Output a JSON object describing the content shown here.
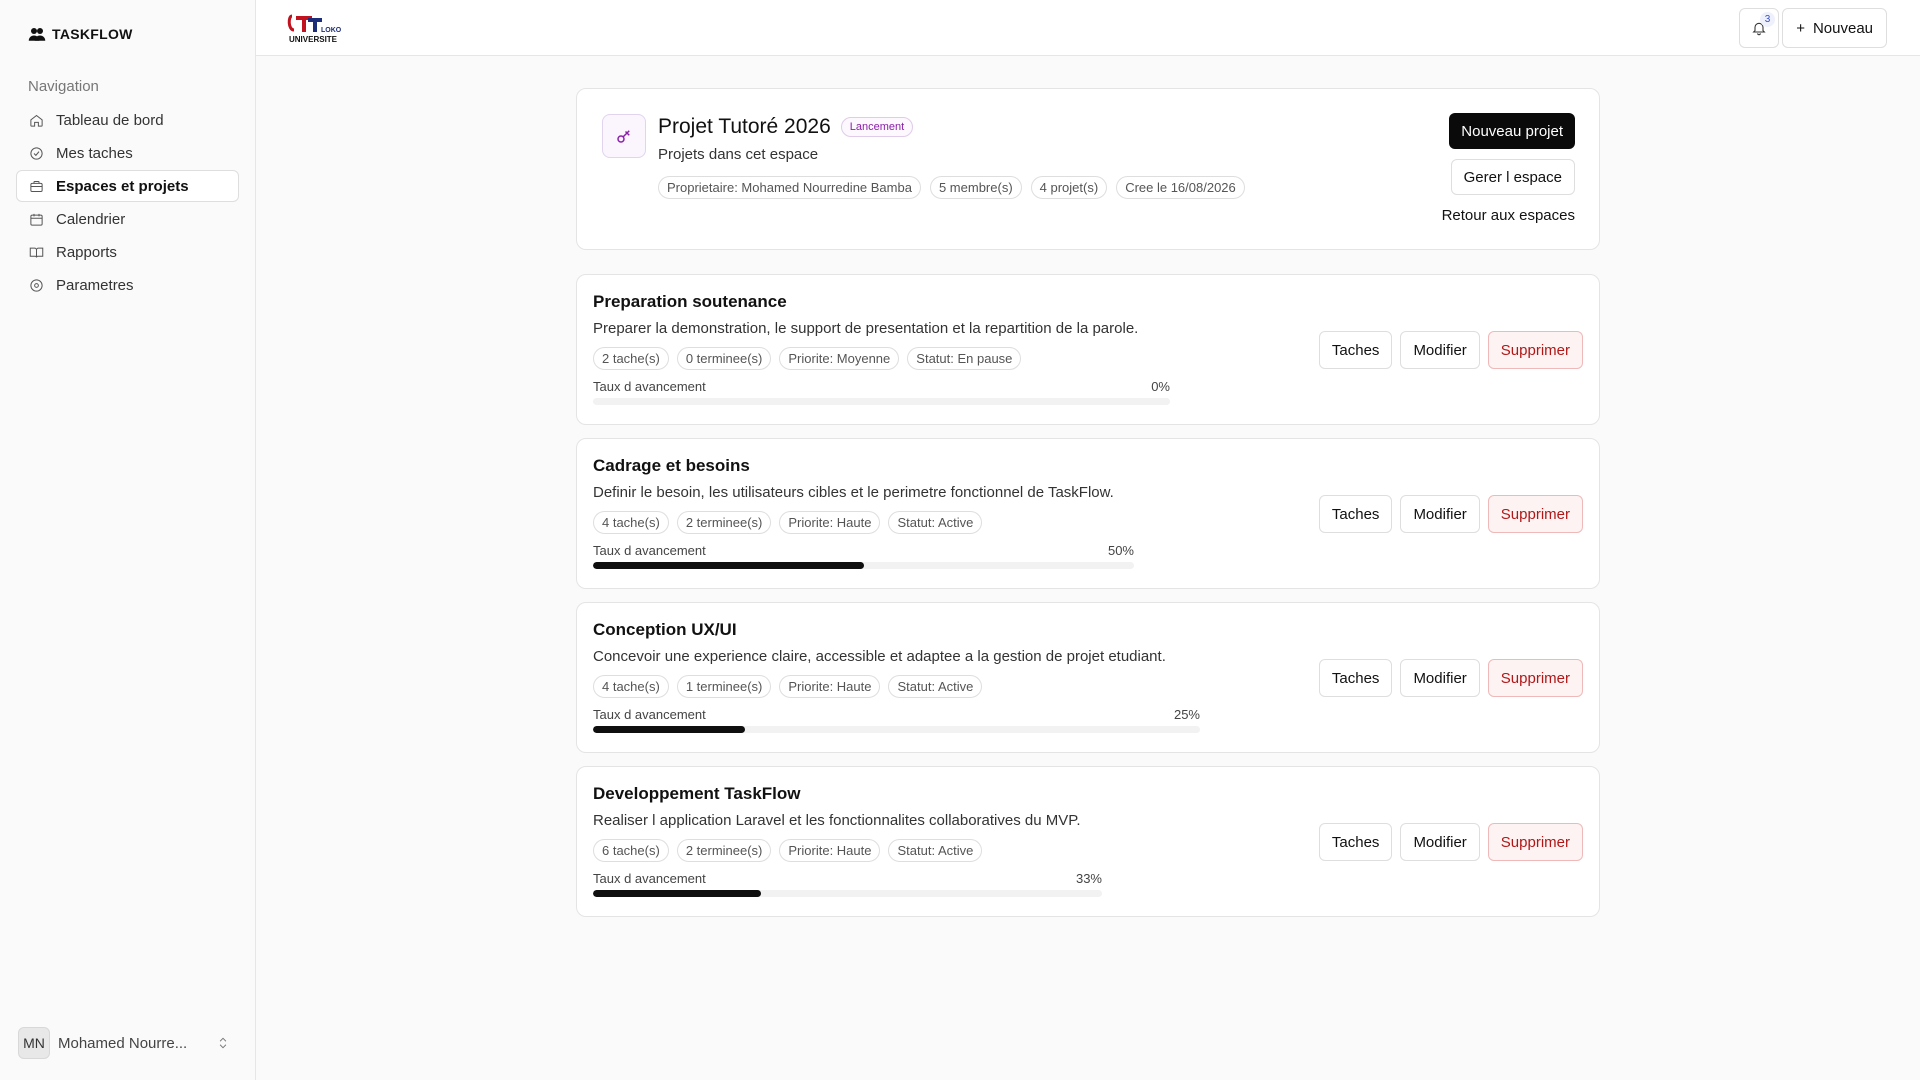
{
  "app": {
    "brand": "TASKFLOW",
    "logo_text_top": "LOKO",
    "logo_text_bottom": "UNIVERSITE"
  },
  "sidebar": {
    "nav_title": "Navigation",
    "items": [
      {
        "label": "Tableau de bord",
        "icon": "home-icon",
        "active": false
      },
      {
        "label": "Mes taches",
        "icon": "check-circle-icon",
        "active": false
      },
      {
        "label": "Espaces et projets",
        "icon": "briefcase-icon",
        "active": true
      },
      {
        "label": "Calendrier",
        "icon": "calendar-icon",
        "active": false
      },
      {
        "label": "Rapports",
        "icon": "book-icon",
        "active": false
      },
      {
        "label": "Parametres",
        "icon": "settings-icon",
        "active": false
      }
    ],
    "user": {
      "initials": "MN",
      "name": "Mohamed Nourre..."
    }
  },
  "topbar": {
    "notifications_count": "3",
    "new_label": "Nouveau"
  },
  "space": {
    "title": "Projet Tutoré 2026",
    "status": "Lancement",
    "subtitle": "Projets dans cet espace",
    "tags": [
      "Proprietaire: Mohamed Nourredine Bamba",
      "5 membre(s)",
      "4 projet(s)",
      "Cree le 16/08/2026"
    ],
    "new_project_label": "Nouveau projet",
    "manage_label": "Gerer l espace",
    "back_label": "Retour aux espaces"
  },
  "actions": {
    "tasks": "Taches",
    "edit": "Modifier",
    "delete": "Supprimer"
  },
  "progress_label": "Taux d avancement",
  "projects": [
    {
      "title": "Preparation soutenance",
      "description": "Preparer la demonstration, le support de presentation et la repartition de la parole.",
      "tags": [
        "2 tache(s)",
        "0 terminee(s)",
        "Priorite: Moyenne",
        "Statut: En pause"
      ],
      "progress": 0,
      "progress_text": "0%"
    },
    {
      "title": "Cadrage et besoins",
      "description": "Definir le besoin, les utilisateurs cibles et le perimetre fonctionnel de TaskFlow.",
      "tags": [
        "4 tache(s)",
        "2 terminee(s)",
        "Priorite: Haute",
        "Statut: Active"
      ],
      "progress": 50,
      "progress_text": "50%"
    },
    {
      "title": "Conception UX/UI",
      "description": "Concevoir une experience claire, accessible et adaptee a la gestion de projet etudiant.",
      "tags": [
        "4 tache(s)",
        "1 terminee(s)",
        "Priorite: Haute",
        "Statut: Active"
      ],
      "progress": 25,
      "progress_text": "25%"
    },
    {
      "title": "Developpement TaskFlow",
      "description": "Realiser l application Laravel et les fonctionnalites collaboratives du MVP.",
      "tags": [
        "6 tache(s)",
        "2 terminee(s)",
        "Priorite: Haute",
        "Statut: Active"
      ],
      "progress": 33,
      "progress_text": "33%"
    }
  ]
}
